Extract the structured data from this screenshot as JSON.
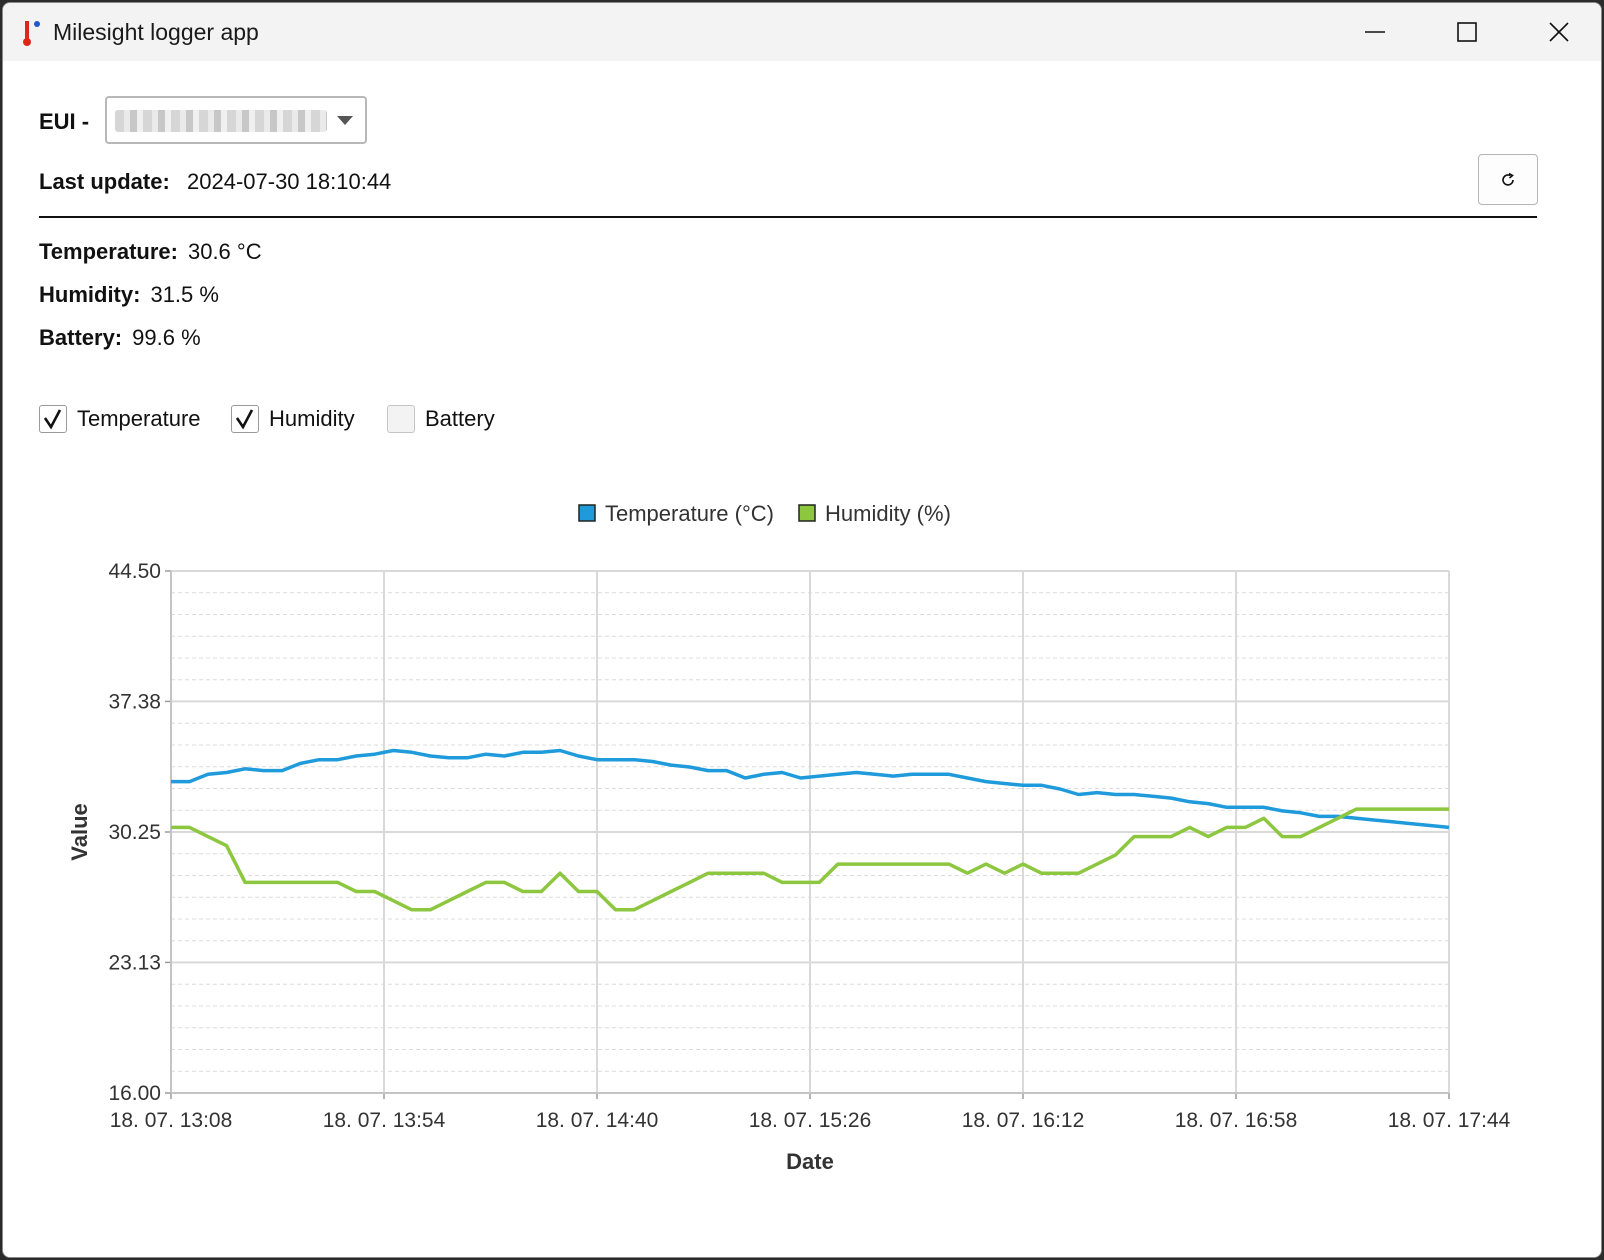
{
  "window": {
    "title": "Milesight logger app"
  },
  "eui": {
    "label": "EUI -"
  },
  "last_update": {
    "label": "Last update:",
    "value": "2024-07-30 18:10:44"
  },
  "readings": {
    "temperature": {
      "label": "Temperature:",
      "value": "30.6 °C"
    },
    "humidity": {
      "label": "Humidity:",
      "value": "31.5 %"
    },
    "battery": {
      "label": "Battery:",
      "value": "99.6 %"
    }
  },
  "toggles": [
    {
      "label": "Temperature",
      "checked": true
    },
    {
      "label": "Humidity",
      "checked": true
    },
    {
      "label": "Battery",
      "checked": false
    }
  ],
  "chart_data": {
    "type": "line",
    "xlabel": "Date",
    "ylabel": "Value",
    "ylim": [
      16.0,
      44.5
    ],
    "y_ticks": [
      "44.50",
      "37.38",
      "30.25",
      "23.13",
      "16.00"
    ],
    "x_range": [
      "18. 07. 13:08",
      "18. 07. 17:44"
    ],
    "x_ticks": [
      "18. 07. 13:08",
      "18. 07. 13:54",
      "18. 07. 14:40",
      "18. 07. 15:26",
      "18. 07. 16:12",
      "18. 07. 16:58",
      "18. 07. 17:44"
    ],
    "grid": true,
    "legend": "top-center",
    "series": [
      {
        "name": "Temperature (°C)",
        "color": "#1f9bdc",
        "points": [
          [
            "18. 07. 13:08",
            33.0
          ],
          [
            "18. 07. 13:12",
            33.0
          ],
          [
            "18. 07. 13:16",
            33.4
          ],
          [
            "18. 07. 13:20",
            33.5
          ],
          [
            "18. 07. 13:24",
            33.7
          ],
          [
            "18. 07. 13:28",
            33.6
          ],
          [
            "18. 07. 13:32",
            33.6
          ],
          [
            "18. 07. 13:36",
            34.0
          ],
          [
            "18. 07. 13:40",
            34.2
          ],
          [
            "18. 07. 13:44",
            34.2
          ],
          [
            "18. 07. 13:48",
            34.4
          ],
          [
            "18. 07. 13:52",
            34.5
          ],
          [
            "18. 07. 13:56",
            34.7
          ],
          [
            "18. 07. 14:00",
            34.6
          ],
          [
            "18. 07. 14:04",
            34.4
          ],
          [
            "18. 07. 14:08",
            34.3
          ],
          [
            "18. 07. 14:12",
            34.3
          ],
          [
            "18. 07. 14:16",
            34.5
          ],
          [
            "18. 07. 14:20",
            34.4
          ],
          [
            "18. 07. 14:24",
            34.6
          ],
          [
            "18. 07. 14:28",
            34.6
          ],
          [
            "18. 07. 14:32",
            34.7
          ],
          [
            "18. 07. 14:36",
            34.4
          ],
          [
            "18. 07. 14:40",
            34.2
          ],
          [
            "18. 07. 14:44",
            34.2
          ],
          [
            "18. 07. 14:48",
            34.2
          ],
          [
            "18. 07. 14:52",
            34.1
          ],
          [
            "18. 07. 14:56",
            33.9
          ],
          [
            "18. 07. 15:00",
            33.8
          ],
          [
            "18. 07. 15:04",
            33.6
          ],
          [
            "18. 07. 15:08",
            33.6
          ],
          [
            "18. 07. 15:12",
            33.2
          ],
          [
            "18. 07. 15:16",
            33.4
          ],
          [
            "18. 07. 15:20",
            33.5
          ],
          [
            "18. 07. 15:24",
            33.2
          ],
          [
            "18. 07. 15:28",
            33.3
          ],
          [
            "18. 07. 15:32",
            33.4
          ],
          [
            "18. 07. 15:36",
            33.5
          ],
          [
            "18. 07. 15:40",
            33.4
          ],
          [
            "18. 07. 15:44",
            33.3
          ],
          [
            "18. 07. 15:48",
            33.4
          ],
          [
            "18. 07. 15:52",
            33.4
          ],
          [
            "18. 07. 15:56",
            33.4
          ],
          [
            "18. 07. 16:00",
            33.2
          ],
          [
            "18. 07. 16:04",
            33.0
          ],
          [
            "18. 07. 16:08",
            32.9
          ],
          [
            "18. 07. 16:12",
            32.8
          ],
          [
            "18. 07. 16:16",
            32.8
          ],
          [
            "18. 07. 16:20",
            32.6
          ],
          [
            "18. 07. 16:24",
            32.3
          ],
          [
            "18. 07. 16:28",
            32.4
          ],
          [
            "18. 07. 16:32",
            32.3
          ],
          [
            "18. 07. 16:36",
            32.3
          ],
          [
            "18. 07. 16:40",
            32.2
          ],
          [
            "18. 07. 16:44",
            32.1
          ],
          [
            "18. 07. 16:48",
            31.9
          ],
          [
            "18. 07. 16:52",
            31.8
          ],
          [
            "18. 07. 16:56",
            31.6
          ],
          [
            "18. 07. 17:00",
            31.6
          ],
          [
            "18. 07. 17:04",
            31.6
          ],
          [
            "18. 07. 17:08",
            31.4
          ],
          [
            "18. 07. 17:12",
            31.3
          ],
          [
            "18. 07. 17:16",
            31.1
          ],
          [
            "18. 07. 17:20",
            31.1
          ],
          [
            "18. 07. 17:24",
            31.0
          ],
          [
            "18. 07. 17:28",
            30.9
          ],
          [
            "18. 07. 17:32",
            30.8
          ],
          [
            "18. 07. 17:36",
            30.7
          ],
          [
            "18. 07. 17:44",
            30.5
          ]
        ]
      },
      {
        "name": "Humidity (%)",
        "color": "#8dc63f",
        "points": [
          [
            "18. 07. 13:08",
            30.5
          ],
          [
            "18. 07. 13:12",
            30.5
          ],
          [
            "18. 07. 13:16",
            30.0
          ],
          [
            "18. 07. 13:20",
            29.5
          ],
          [
            "18. 07. 13:24",
            27.5
          ],
          [
            "18. 07. 13:28",
            27.5
          ],
          [
            "18. 07. 13:32",
            27.5
          ],
          [
            "18. 07. 13:36",
            27.5
          ],
          [
            "18. 07. 13:40",
            27.5
          ],
          [
            "18. 07. 13:44",
            27.5
          ],
          [
            "18. 07. 13:48",
            27.0
          ],
          [
            "18. 07. 13:52",
            27.0
          ],
          [
            "18. 07. 13:56",
            26.5
          ],
          [
            "18. 07. 14:00",
            26.0
          ],
          [
            "18. 07. 14:04",
            26.0
          ],
          [
            "18. 07. 14:08",
            26.5
          ],
          [
            "18. 07. 14:12",
            27.0
          ],
          [
            "18. 07. 14:16",
            27.5
          ],
          [
            "18. 07. 14:20",
            27.5
          ],
          [
            "18. 07. 14:24",
            27.0
          ],
          [
            "18. 07. 14:28",
            27.0
          ],
          [
            "18. 07. 14:32",
            28.0
          ],
          [
            "18. 07. 14:36",
            27.0
          ],
          [
            "18. 07. 14:40",
            27.0
          ],
          [
            "18. 07. 14:44",
            26.0
          ],
          [
            "18. 07. 14:48",
            26.0
          ],
          [
            "18. 07. 14:52",
            26.5
          ],
          [
            "18. 07. 14:56",
            27.0
          ],
          [
            "18. 07. 15:00",
            27.5
          ],
          [
            "18. 07. 15:04",
            28.0
          ],
          [
            "18. 07. 15:08",
            28.0
          ],
          [
            "18. 07. 15:12",
            28.0
          ],
          [
            "18. 07. 15:16",
            28.0
          ],
          [
            "18. 07. 15:20",
            27.5
          ],
          [
            "18. 07. 15:24",
            27.5
          ],
          [
            "18. 07. 15:28",
            27.5
          ],
          [
            "18. 07. 15:32",
            28.5
          ],
          [
            "18. 07. 15:36",
            28.5
          ],
          [
            "18. 07. 15:40",
            28.5
          ],
          [
            "18. 07. 15:44",
            28.5
          ],
          [
            "18. 07. 15:48",
            28.5
          ],
          [
            "18. 07. 15:52",
            28.5
          ],
          [
            "18. 07. 15:56",
            28.5
          ],
          [
            "18. 07. 16:00",
            28.0
          ],
          [
            "18. 07. 16:04",
            28.5
          ],
          [
            "18. 07. 16:08",
            28.0
          ],
          [
            "18. 07. 16:12",
            28.5
          ],
          [
            "18. 07. 16:16",
            28.0
          ],
          [
            "18. 07. 16:20",
            28.0
          ],
          [
            "18. 07. 16:24",
            28.0
          ],
          [
            "18. 07. 16:28",
            28.5
          ],
          [
            "18. 07. 16:32",
            29.0
          ],
          [
            "18. 07. 16:36",
            30.0
          ],
          [
            "18. 07. 16:40",
            30.0
          ],
          [
            "18. 07. 16:44",
            30.0
          ],
          [
            "18. 07. 16:48",
            30.5
          ],
          [
            "18. 07. 16:52",
            30.0
          ],
          [
            "18. 07. 16:56",
            30.5
          ],
          [
            "18. 07. 17:00",
            30.5
          ],
          [
            "18. 07. 17:04",
            31.0
          ],
          [
            "18. 07. 17:08",
            30.0
          ],
          [
            "18. 07. 17:12",
            30.0
          ],
          [
            "18. 07. 17:16",
            30.5
          ],
          [
            "18. 07. 17:20",
            31.0
          ],
          [
            "18. 07. 17:24",
            31.5
          ],
          [
            "18. 07. 17:28",
            31.5
          ],
          [
            "18. 07. 17:32",
            31.5
          ],
          [
            "18. 07. 17:36",
            31.5
          ],
          [
            "18. 07. 17:44",
            31.5
          ]
        ]
      }
    ]
  }
}
